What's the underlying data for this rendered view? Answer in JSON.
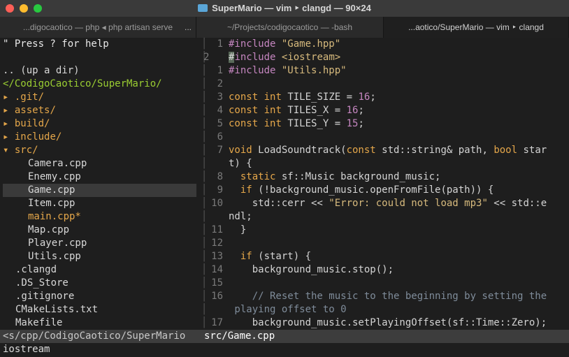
{
  "window": {
    "title": "SuperMario — vim ‣ clangd — 90×24",
    "tabs": [
      {
        "label": "...digocaotico — php ◂ php artisan serve",
        "more": "..."
      },
      {
        "label": "~/Projects/codigocaotico — -bash"
      },
      {
        "label": "...aotico/SuperMario — vim ‣ clangd"
      }
    ]
  },
  "colors": {
    "accent_keyword": "#e5a74a",
    "string": "#d7ba7d",
    "preprocessor": "#c586c0",
    "tree_path": "#9acd32"
  },
  "file_tree": {
    "help": "\" Press ? for help",
    "up_dir": ".. (up a dir)",
    "root": "</CodigoCaotico/SuperMario/",
    "entries": [
      {
        "marker": "▸",
        "name": ".git/"
      },
      {
        "marker": "▸",
        "name": "assets/"
      },
      {
        "marker": "▸",
        "name": "build/"
      },
      {
        "marker": "▸",
        "name": "include/"
      },
      {
        "marker": "▾",
        "name": "src/"
      },
      {
        "name": "Camera.cpp"
      },
      {
        "name": "Enemy.cpp"
      },
      {
        "name": "Game.cpp"
      },
      {
        "name": "Item.cpp"
      },
      {
        "name": "main.cpp*"
      },
      {
        "name": "Map.cpp"
      },
      {
        "name": "Player.cpp"
      },
      {
        "name": "Utils.cpp"
      },
      {
        "name": ".clangd"
      },
      {
        "name": ".DS_Store"
      },
      {
        "name": ".gitignore"
      },
      {
        "name": "CMakeLists.txt"
      },
      {
        "name": "Makefile"
      }
    ]
  },
  "editor": {
    "lines": [
      {
        "num": "1",
        "text": "#include \"Game.hpp\""
      },
      {
        "num": "2",
        "text": "#include <iostream>"
      },
      {
        "num": "1",
        "text": "#include \"Utils.hpp\""
      },
      {
        "num": "2",
        "text": ""
      },
      {
        "num": "3",
        "text": "const int TILE_SIZE = 16;"
      },
      {
        "num": "4",
        "text": "const int TILES_X = 16;"
      },
      {
        "num": "5",
        "text": "const int TILES_Y = 15;"
      },
      {
        "num": "6",
        "text": ""
      },
      {
        "num": "7",
        "text": "void LoadSoundtrack(const std::string& path, bool star"
      },
      {
        "num": "",
        "text": "t) {"
      },
      {
        "num": "8",
        "text": "  static sf::Music background_music;"
      },
      {
        "num": "9",
        "text": "  if (!background_music.openFromFile(path)) {"
      },
      {
        "num": "10",
        "text": "    std::cerr << \"Error: could not load mp3\" << std::e"
      },
      {
        "num": "",
        "text": "ndl;"
      },
      {
        "num": "11",
        "text": "  }"
      },
      {
        "num": "12",
        "text": ""
      },
      {
        "num": "13",
        "text": "  if (start) {"
      },
      {
        "num": "14",
        "text": "    background_music.stop();"
      },
      {
        "num": "15",
        "text": ""
      },
      {
        "num": "16",
        "text": "    // Reset the music to the beginning by setting the"
      },
      {
        "num": "",
        "text": " playing offset to 0"
      },
      {
        "num": "17",
        "text": "    background_music.setPlayingOffset(sf::Time::Zero);"
      }
    ]
  },
  "status": {
    "left": "<s/cpp/CodigoCaotico/SuperMario",
    "right": "src/Game.cpp"
  },
  "cmdline": "iostream"
}
